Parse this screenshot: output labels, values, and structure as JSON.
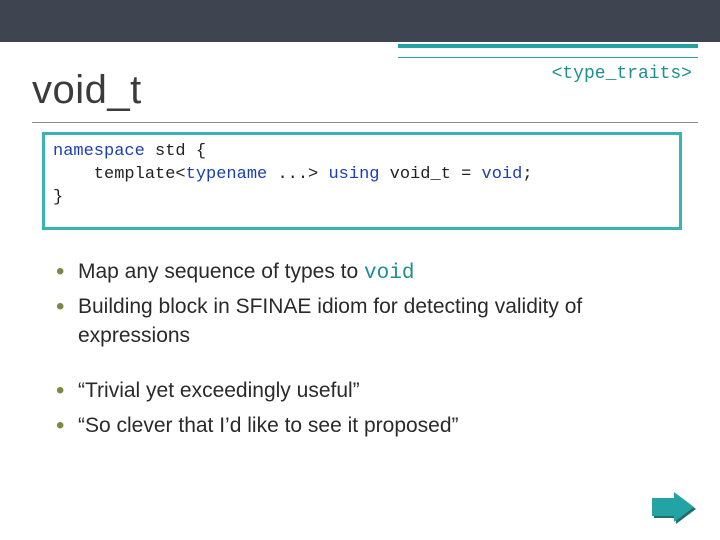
{
  "header_tag": "<type_traits>",
  "title": "void_t",
  "code": {
    "line1": {
      "kw": "namespace",
      "rest": " std {"
    },
    "line2": {
      "pre": "    template<",
      "kw1": "typename",
      "mid": " ...> ",
      "kw2": "using",
      "post": " void_t = ",
      "kw3": "void",
      "end": ";"
    },
    "line3": "}"
  },
  "bullets_a": [
    {
      "pre": "Map any sequence of types to ",
      "mono": "void"
    },
    {
      "pre": "Building block in SFINAE idiom for detecting validity of expressions"
    }
  ],
  "bullets_b": [
    "“Trivial yet exceedingly useful”",
    "“So clever that I’d like to see it proposed”"
  ]
}
